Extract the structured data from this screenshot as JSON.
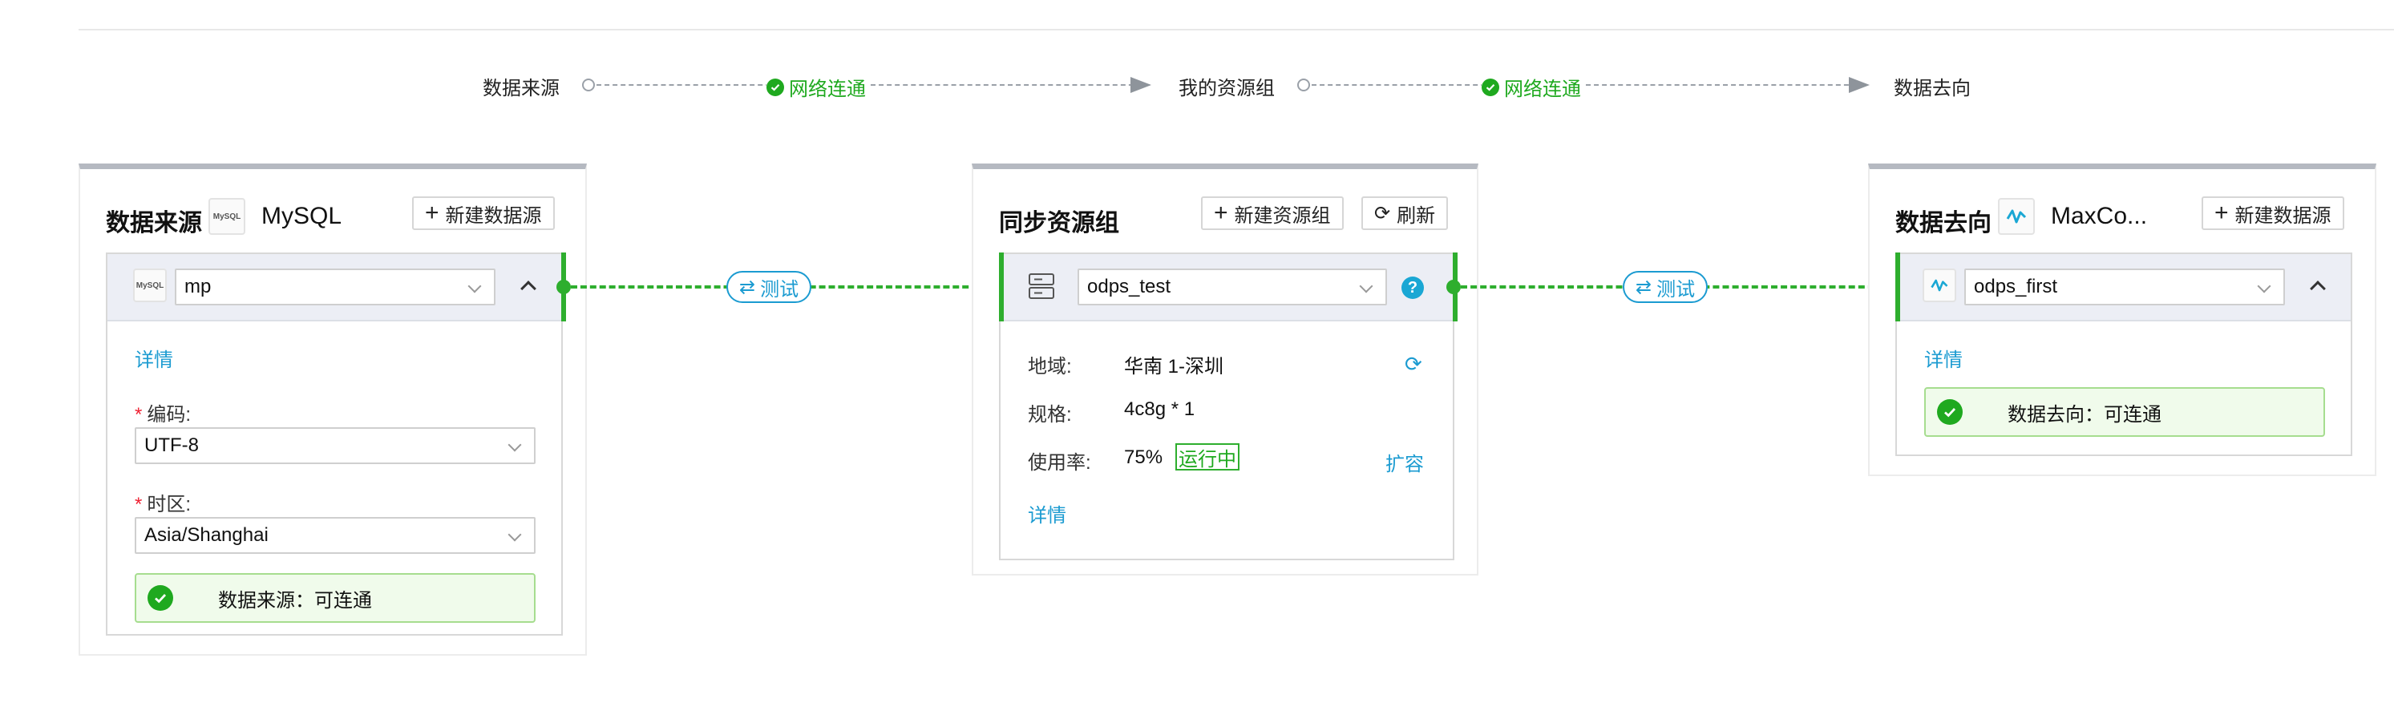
{
  "flow": {
    "source_label": "数据来源",
    "group_label": "我的资源组",
    "dest_label": "数据去向",
    "net_status_1": "网络连通",
    "net_status_2": "网络连通"
  },
  "colors": {
    "success": "#1fa91f",
    "link": "#1b9bd1",
    "connector": "#2eae2e"
  },
  "source_panel": {
    "title": "数据来源",
    "type_name": "MySQL",
    "logo_text": "MySQL",
    "new_button": "新建数据源",
    "datasource_value": "mp",
    "details_link": "详情",
    "encoding_label": "编码:",
    "encoding_value": "UTF-8",
    "timezone_label": "时区:",
    "timezone_value": "Asia/Shanghai",
    "status_text": "数据来源：可连通"
  },
  "test_left": {
    "label": "测试"
  },
  "group_panel": {
    "title": "同步资源组",
    "new_button": "新建资源组",
    "refresh_button": "刷新",
    "group_value": "odps_test",
    "help_icon_text": "?",
    "region_label": "地域:",
    "region_value": "华南 1-深圳",
    "spec_label": "规格:",
    "spec_value": "4c8g * 1",
    "usage_label": "使用率:",
    "usage_value": "75%",
    "status_tag": "运行中",
    "expand_link": "扩容",
    "details_link": "详情"
  },
  "test_right": {
    "label": "测试"
  },
  "dest_panel": {
    "title": "数据去向",
    "type_name": "MaxCo...",
    "new_button": "新建数据源",
    "datasource_value": "odps_first",
    "details_link": "详情",
    "status_text": "数据去向：可连通"
  }
}
